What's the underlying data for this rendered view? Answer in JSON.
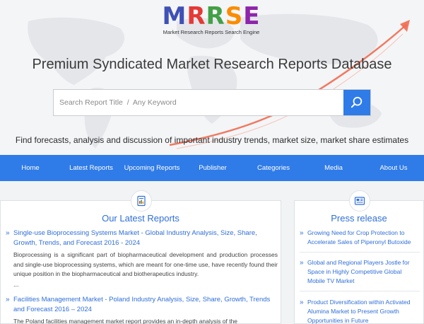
{
  "logo": {
    "letters": [
      "M",
      "R",
      "R",
      "S",
      "E"
    ],
    "letter_colors": [
      "#3f51b5",
      "#e53935",
      "#43a047",
      "#fb8c00",
      "#8e24aa"
    ],
    "tagline": "Market Research Reports Search Engine"
  },
  "hero": {
    "title": "Premium Syndicated Market Research Reports Database",
    "search_placeholder": "Search Report Title  /  Any Keyword",
    "search_icon": "search-icon",
    "subtitle": "Find forecasts, analysis and discussion of important industry trends, market size, market share estimates"
  },
  "nav": {
    "items": [
      "Home",
      "Latest Reports",
      "Upcoming Reports",
      "Publisher",
      "Categories",
      "Media",
      "About Us"
    ]
  },
  "latest": {
    "title": "Our Latest Reports",
    "icon": "report-document-icon",
    "reports": [
      {
        "title": "Single-use Bioprocessing Systems Market - Global Industry Analysis, Size, Share, Growth, Trends, and Forecast 2016 - 2024",
        "desc": "Bioprocessing is a significant part of biopharmaceutical development and production processes and single-use bioprocessing systems, which are meant for one-time use, have recently found their unique position in the biopharmaceutical and biotherapeutics industry.",
        "more": "..."
      },
      {
        "title": "Facilities Management Market - Poland Industry Analysis, Size, Share, Growth, Trends and Forecast 2016 – 2024",
        "desc": "The Poland facilities management market report provides an in-depth analysis of the"
      }
    ]
  },
  "press": {
    "title": "Press release",
    "icon": "newspaper-icon",
    "items": [
      "Growing Need for Crop Protection to Accelerate Sales of Piperonyl Butoxide",
      "Global and Regional Players Jostle for Space in Highly Competitive Global Mobile TV Market",
      "Product Diversification within Activated Alumina Market to Present Growth Opportunities in Future"
    ]
  },
  "colors": {
    "accent": "#2f7be8",
    "link": "#2f6fd8",
    "hero_arrow": "#f26a4f"
  }
}
